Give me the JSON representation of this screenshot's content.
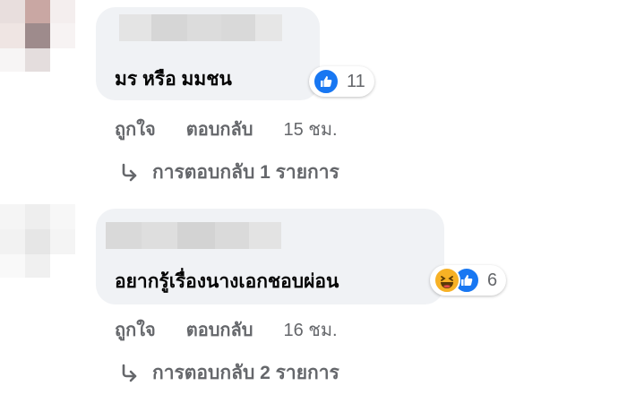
{
  "colors": {
    "bubble": "#f0f2f5",
    "secondary_text": "#65676b",
    "primary_text": "#050505",
    "like_blue": "#1877f2",
    "haha_yellow": "#f7b125"
  },
  "comments": [
    {
      "text": "มร หรือ มมชน",
      "reactions": {
        "icons": [
          "like-icon"
        ],
        "count": "11"
      },
      "actions": {
        "like": "ถูกใจ",
        "reply": "ตอบกลับ",
        "time": "15 ชม."
      },
      "replies_link": "การตอบกลับ 1 รายการ"
    },
    {
      "text": "อยากรู้เรื่องนางเอกชอบผ่อน",
      "reactions": {
        "icons": [
          "haha-icon",
          "like-icon"
        ],
        "count": "6"
      },
      "actions": {
        "like": "ถูกใจ",
        "reply": "ตอบกลับ",
        "time": "16 ชม."
      },
      "replies_link": "การตอบกลับ 2 รายการ"
    }
  ]
}
